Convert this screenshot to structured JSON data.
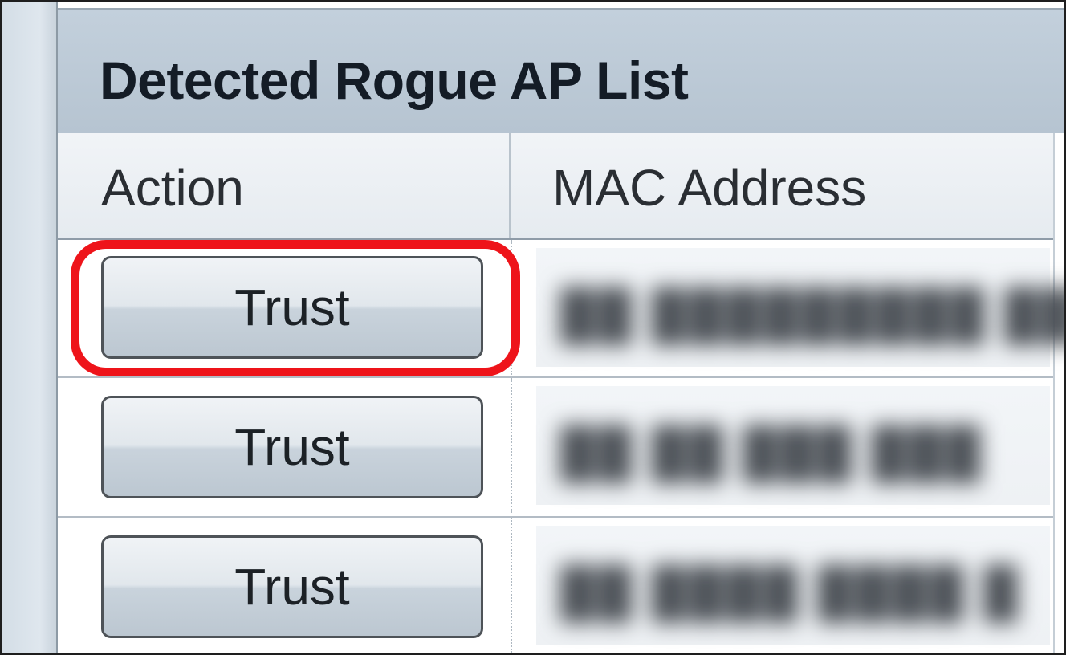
{
  "panel": {
    "title": "Detected Rogue AP List"
  },
  "table": {
    "columns": {
      "action": "Action",
      "mac_address": "MAC Address"
    },
    "rows": [
      {
        "action_label": "Trust",
        "mac_address": "██ █████████ ██"
      },
      {
        "action_label": "Trust",
        "mac_address": "██ ██ ███ ███"
      },
      {
        "action_label": "Trust",
        "mac_address": "██ ████ ████ █"
      }
    ],
    "highlighted_row": 0
  },
  "colors": {
    "highlight": "#ee141a",
    "header_bg": "#b6c4d1"
  }
}
